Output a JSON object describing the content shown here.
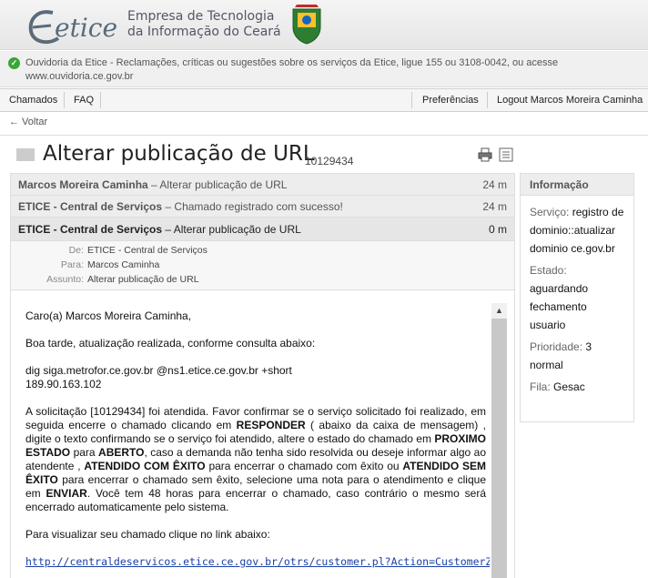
{
  "header": {
    "logo_text": "etice",
    "company_line1": "Empresa de Tecnologia",
    "company_line2": "da Informação do Ceará"
  },
  "notice": {
    "text": "Ouvidoria da Etice - Reclamações, críticas ou sugestões sobre os serviços da Etice, ligue 155 ou 3108-0042, ou acesse www.ouvidoria.ce.gov.br"
  },
  "nav": {
    "chamados": "Chamados",
    "faq": "FAQ",
    "preferencias": "Preferências",
    "logout": "Logout Marcos Moreira Caminha"
  },
  "back_label": "← Voltar",
  "ticket": {
    "title": "Alterar publicação de URL",
    "number": "10129434"
  },
  "messages": [
    {
      "from": "Marcos Moreira Caminha",
      "subject": " – Alterar publicação de URL",
      "time": "24 m"
    },
    {
      "from": "ETICE - Central de Serviços",
      "subject": " – Chamado registrado com sucesso!",
      "time": "24 m"
    },
    {
      "from": "ETICE - Central de Serviços",
      "subject": " – Alterar publicação de URL",
      "time": "0 m"
    }
  ],
  "meta": {
    "de_label": "De:",
    "de_value": "ETICE - Central de Serviços",
    "para_label": "Para:",
    "para_value": "Marcos Caminha",
    "assunto_label": "Assunto:",
    "assunto_value": "Alterar publicação de URL"
  },
  "body": {
    "greeting": "Caro(a) Marcos Moreira Caminha,",
    "line1": "Boa tarde, atualização realizada, conforme consulta abaixo:",
    "cmd": "dig siga.metrofor.ce.gov.br @ns1.etice.ce.gov.br +short",
    "ip": "189.90.163.102",
    "p_a": "A solicitação [10129434] foi atendida. Favor confirmar se o serviço solicitado foi realizado, em seguida encerre o chamado clicando em ",
    "b_responder": "RESPONDER",
    "p_b": " ( abaixo da caixa de mensagem) , digite o texto confirmando se o serviço foi atendido, altere o estado do chamado em ",
    "b_proximo": "PROXIMO ESTADO",
    "p_c": " para ",
    "b_aberto": "ABERTO",
    "p_d": ", caso a demanda não tenha sido resolvida ou deseje informar algo ao atendente , ",
    "b_atendido_exito": "ATENDIDO COM ÊXITO",
    "p_e": " para encerrar o chamado com êxito ou ",
    "b_atendido_sem": "ATENDIDO SEM ÊXITO",
    "p_f": " para encerrar o chamado sem êxito, selecione uma nota para o atendimento e clique em ",
    "b_enviar": "ENVIAR",
    "p_g": ". Você tem 48 horas para encerrar o chamado, caso contrário o mesmo será encerrado automaticamente pelo sistema.",
    "visualizar": "Para visualizar seu chamado clique no link abaixo:",
    "link": "http://centraldeservicos.etice.ce.gov.br/otrs/customer.pl?Action=CustomerZoom"
  },
  "info": {
    "heading": "Informação",
    "servico_label": "Serviço:",
    "servico_value": "registro de dominio::atualizar dominio ce.gov.br",
    "estado_label": "Estado:",
    "estado_value": "aguardando fechamento usuario",
    "prioridade_label": "Prioridade:",
    "prioridade_value": "3 normal",
    "fila_label": "Fila:",
    "fila_value": "Gesac"
  },
  "icons": {
    "print": "printer-icon",
    "zoom": "document-icon",
    "ok": "check-circle-icon"
  },
  "colors": {
    "link": "#1a40a8",
    "ok": "#3aa635"
  }
}
